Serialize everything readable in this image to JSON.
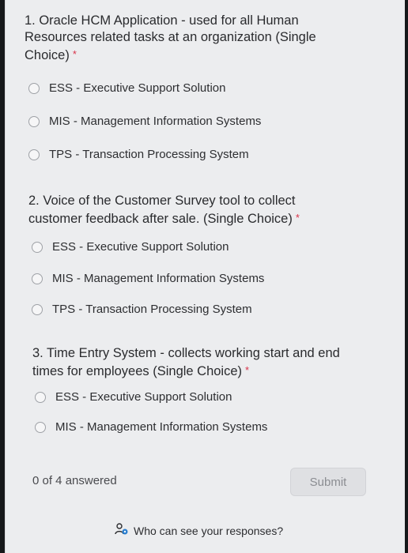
{
  "questions": [
    {
      "title": "1. Oracle HCM Application - used for all Human Resources related tasks at an organization (Single Choice)",
      "required_mark": "*",
      "options": [
        "ESS - Executive Support Solution",
        "MIS - Management Information Systems",
        "TPS - Transaction Processing System"
      ]
    },
    {
      "title": "2. Voice of the Customer Survey tool to collect customer feedback after sale. (Single Choice)",
      "required_mark": "*",
      "options": [
        "ESS - Executive Support Solution",
        "MIS - Management Information Systems",
        "TPS - Transaction Processing System"
      ]
    },
    {
      "title": "3. Time Entry System - collects working start and end times for employees (Single Choice)",
      "required_mark": "*",
      "options": [
        "ESS - Executive Support Solution",
        "MIS - Management Information Systems"
      ]
    }
  ],
  "footer": {
    "status": "0 of 4 answered",
    "submit_label": "Submit",
    "privacy_link": "Who can see your responses?",
    "privacy_icon": "person-visibility-icon"
  }
}
